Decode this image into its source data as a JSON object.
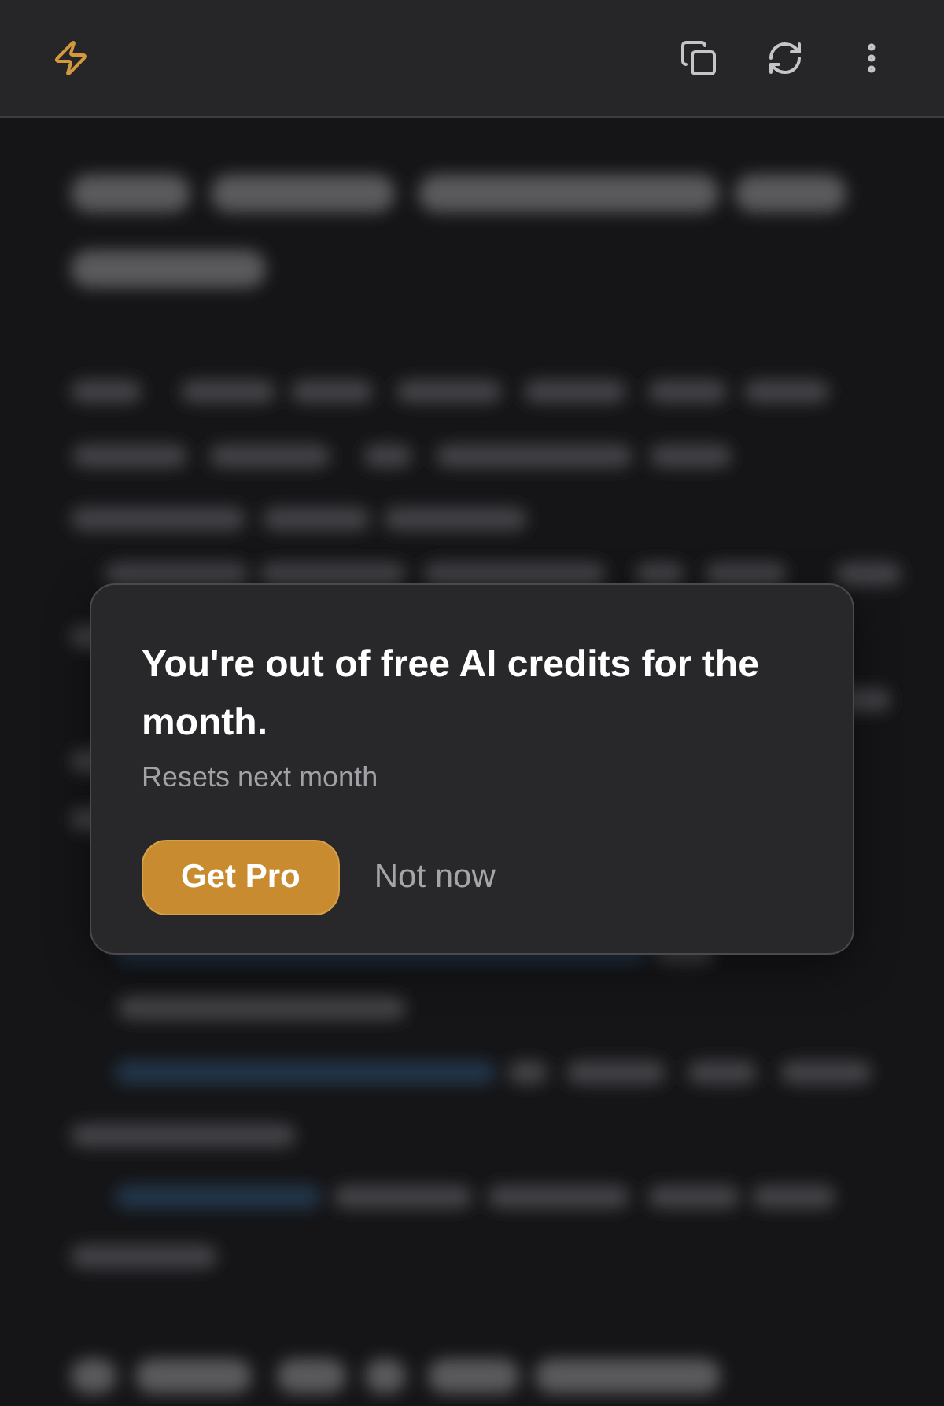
{
  "dialog": {
    "title": "You're out of free AI credits for the month.",
    "subtitle": "Resets next month",
    "buttons": [
      {
        "kind": "primary",
        "label": "Get Pro"
      },
      {
        "kind": "secondary",
        "label": "Not now"
      }
    ]
  }
}
